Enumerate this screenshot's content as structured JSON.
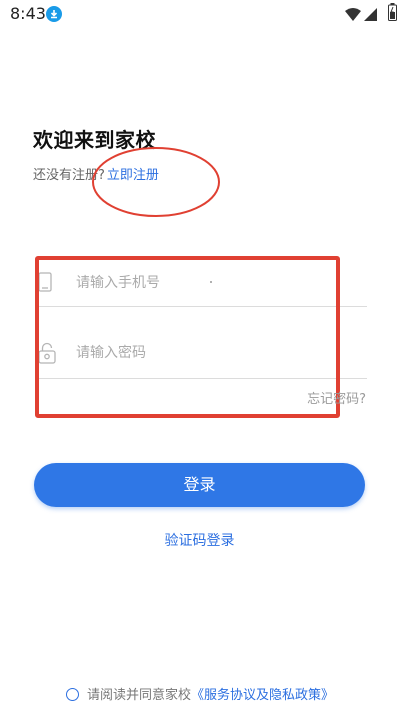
{
  "status_bar": {
    "time": "8:43"
  },
  "header": {
    "welcome": "欢迎来到家校",
    "register_prompt": "还没有注册?",
    "register_link": "立即注册"
  },
  "form": {
    "phone_placeholder": "请输入手机号",
    "password_placeholder": "请输入密码",
    "forgot_password": "忘记密码?"
  },
  "actions": {
    "login": "登录",
    "code_login": "验证码登录"
  },
  "agreement": {
    "text": "请阅读并同意家校",
    "link": "《服务协议及隐私政策》"
  },
  "colors": {
    "primary": "#2f77e6",
    "link": "#2c6fe0",
    "annotation_red": "#e04032"
  }
}
